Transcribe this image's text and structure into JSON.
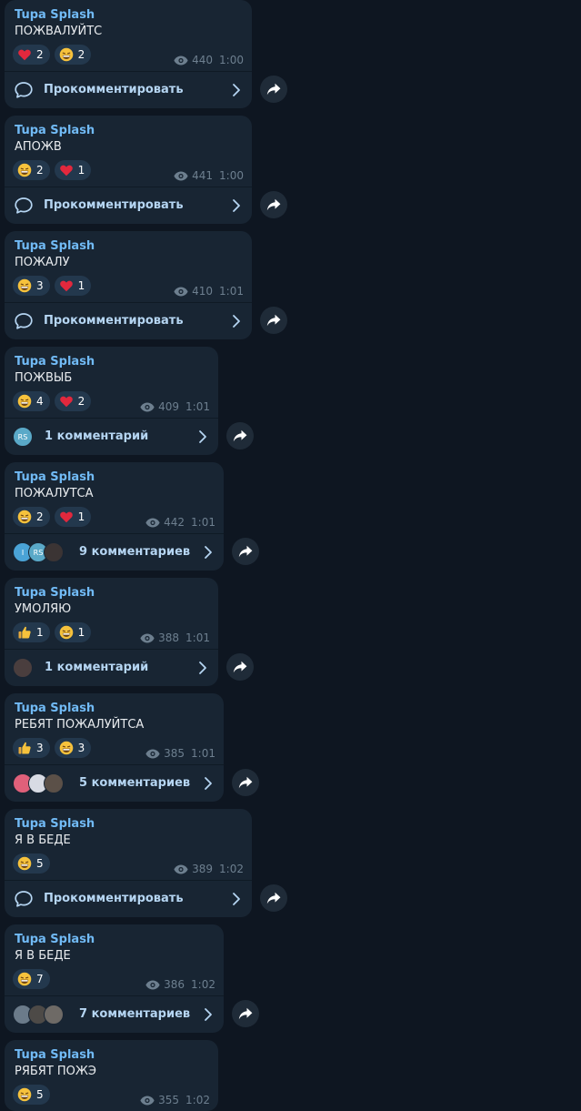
{
  "channel": {
    "author": "Tupa Splash"
  },
  "labels": {
    "comment_action": "Прокомментировать"
  },
  "colors": {
    "background": "#0e1621",
    "bubble": "#182533",
    "author": "#71baf5",
    "footer_text": "#b5d5f2",
    "meta": "#6d7f8f",
    "reaction_pill": "#23384d"
  },
  "messages": [
    {
      "text": "ПОЖВАЛУЙТС",
      "views": "440",
      "time": "1:00",
      "reactions": [
        {
          "emoji": "heart-icon",
          "count": "2"
        },
        {
          "emoji": "grin-icon",
          "count": "2"
        }
      ],
      "footer": {
        "type": "comment_prompt",
        "label": "Прокомментировать"
      }
    },
    {
      "text": "АПОЖВ",
      "views": "441",
      "time": "1:00",
      "reactions": [
        {
          "emoji": "grin-icon",
          "count": "2"
        },
        {
          "emoji": "heart-icon",
          "count": "1"
        }
      ],
      "footer": {
        "type": "comment_prompt",
        "label": "Прокомментировать"
      }
    },
    {
      "text": "ПОЖАЛУ",
      "views": "410",
      "time": "1:01",
      "reactions": [
        {
          "emoji": "grin-icon",
          "count": "3"
        },
        {
          "emoji": "heart-icon",
          "count": "1"
        }
      ],
      "footer": {
        "type": "comment_prompt",
        "label": "Прокомментировать"
      }
    },
    {
      "text": "ПОЖВЫБ",
      "views": "409",
      "time": "1:01",
      "reactions": [
        {
          "emoji": "grin-icon",
          "count": "4"
        },
        {
          "emoji": "heart-icon",
          "count": "2"
        }
      ],
      "footer": {
        "type": "comments",
        "label": "1 комментарий",
        "avatars": [
          {
            "initials": "RS",
            "color": "#5aa9c8"
          }
        ]
      }
    },
    {
      "text": "ПОЖАЛУТСА",
      "views": "442",
      "time": "1:01",
      "reactions": [
        {
          "emoji": "grin-icon",
          "count": "2"
        },
        {
          "emoji": "heart-icon",
          "count": "1"
        }
      ],
      "footer": {
        "type": "comments",
        "label": "9 комментариев",
        "avatars": [
          {
            "initials": "I",
            "color": "#4aa3d6"
          },
          {
            "initials": "RS",
            "color": "#5aa9c8"
          },
          {
            "initials": "",
            "color": "#3b3434"
          }
        ]
      }
    },
    {
      "text": "УМОЛЯЮ",
      "views": "388",
      "time": "1:01",
      "reactions": [
        {
          "emoji": "thumbs-up-icon",
          "count": "1"
        },
        {
          "emoji": "grin-icon",
          "count": "1"
        }
      ],
      "footer": {
        "type": "comments",
        "label": "1 комментарий",
        "avatars": [
          {
            "initials": "",
            "color": "#4a3e3e"
          }
        ]
      }
    },
    {
      "text": "РЕБЯТ ПОЖАЛУЙТСА",
      "views": "385",
      "time": "1:01",
      "reactions": [
        {
          "emoji": "thumbs-up-icon",
          "count": "3"
        },
        {
          "emoji": "grin-icon",
          "count": "3"
        }
      ],
      "footer": {
        "type": "comments",
        "label": "5 комментариев",
        "avatars": [
          {
            "initials": "",
            "color": "#e0607a"
          },
          {
            "initials": "",
            "color": "#d8dbe4"
          },
          {
            "initials": "",
            "color": "#5b5048"
          }
        ]
      }
    },
    {
      "text": "Я В БЕДЕ",
      "views": "389",
      "time": "1:02",
      "reactions": [
        {
          "emoji": "grin-icon",
          "count": "5"
        }
      ],
      "footer": {
        "type": "comment_prompt",
        "label": "Прокомментировать"
      }
    },
    {
      "text": "Я В БЕДЕ",
      "views": "386",
      "time": "1:02",
      "reactions": [
        {
          "emoji": "grin-icon",
          "count": "7"
        }
      ],
      "footer": {
        "type": "comments",
        "label": "7 комментариев",
        "avatars": [
          {
            "initials": "",
            "color": "#6b7b8a"
          },
          {
            "initials": "",
            "color": "#4d4a47"
          },
          {
            "initials": "",
            "color": "#6e6a66"
          }
        ]
      }
    },
    {
      "text": "РЯБЯТ ПОЖЭ",
      "views": "355",
      "time": "1:02",
      "reactions": [
        {
          "emoji": "grin-icon",
          "count": "5"
        }
      ],
      "footer": {
        "type": "none"
      }
    }
  ]
}
